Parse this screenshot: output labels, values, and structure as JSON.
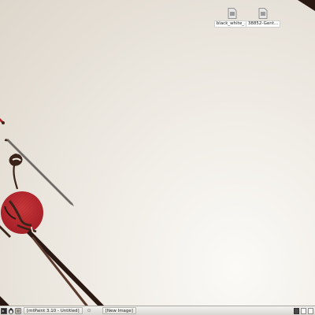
{
  "desktop": {
    "icons": [
      {
        "label": "black_white_...",
        "icon": "file-icon"
      },
      {
        "label": "38852-Gent...",
        "icon": "file-icon"
      }
    ],
    "colors": {
      "accent_red": "#b3242a",
      "dark_brown": "#3a2319"
    }
  },
  "taskbar": {
    "launchers": [
      {
        "icon": "terminal-icon"
      },
      {
        "icon": "penguin-icon"
      },
      {
        "icon": "app-icon"
      }
    ],
    "windows": [
      {
        "label": "[mtPaint 3.10 - Untitled]"
      },
      {
        "label": "[New Image]"
      }
    ],
    "separator": "⊙",
    "tray": [
      {
        "icon": "network-icon"
      },
      {
        "icon": "volume-icon"
      },
      {
        "icon": "display-icon"
      }
    ]
  }
}
